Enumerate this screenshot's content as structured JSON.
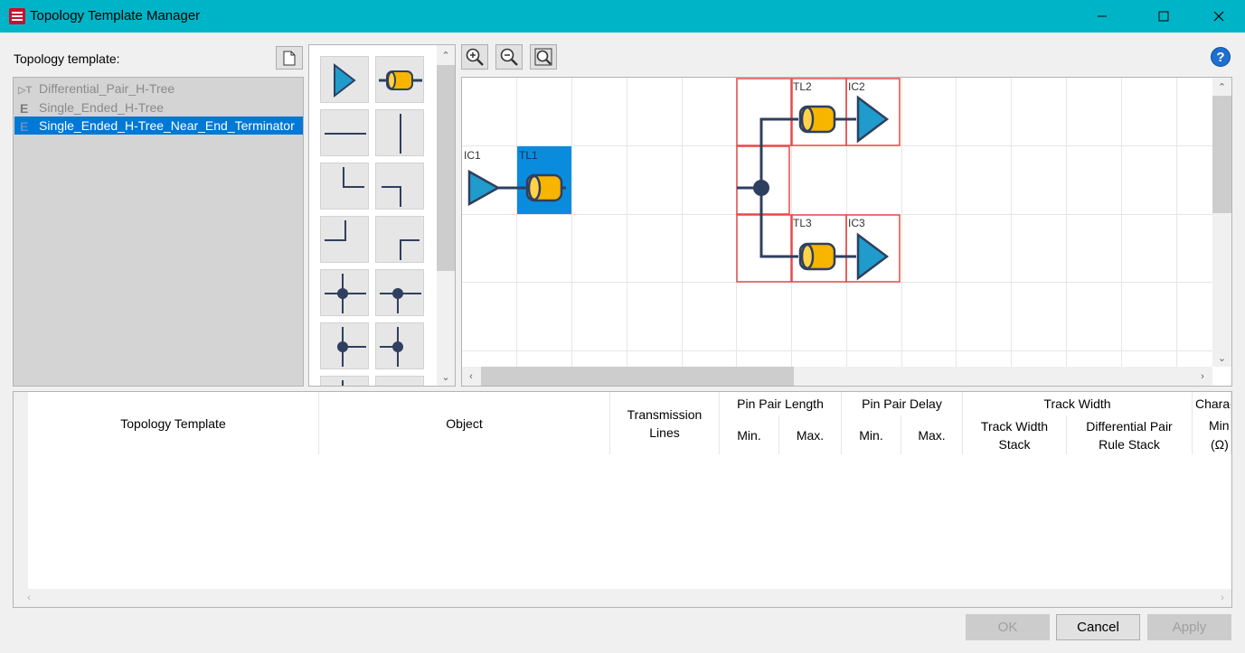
{
  "window": {
    "title": "Topology Template Manager",
    "minimize_glyph": "—",
    "maximize_glyph": "☐",
    "close_glyph": "✕"
  },
  "templates": {
    "label": "Topology template:",
    "items": [
      {
        "name": "Differential_Pair_H-Tree",
        "selected": false
      },
      {
        "name": "Single_Ended_H-Tree",
        "selected": false
      },
      {
        "name": "Single_Ended_H-Tree_Near_End_Terminator",
        "selected": true
      }
    ]
  },
  "palette": {
    "items": [
      "ic-driver",
      "transmission-line",
      "horizontal-wire",
      "vertical-wire",
      "corner-top-right",
      "corner-bottom-left",
      "corner-top-left",
      "corner-bottom-right",
      "tee-vertical",
      "tee-vertical-alt",
      "tee-left",
      "tee-right"
    ]
  },
  "canvas": {
    "components": [
      {
        "label": "IC1",
        "kind": "ic"
      },
      {
        "label": "TL1",
        "kind": "tline",
        "selected": true
      },
      {
        "label": "TL2",
        "kind": "tline"
      },
      {
        "label": "IC2",
        "kind": "ic"
      },
      {
        "label": "TL3",
        "kind": "tline"
      },
      {
        "label": "IC3",
        "kind": "ic"
      }
    ]
  },
  "table": {
    "columns": {
      "topology_template": "Topology Template",
      "object": "Object",
      "transmission_lines": "Transmission Lines",
      "pin_pair_length": "Pin Pair Length",
      "pin_pair_delay": "Pin Pair Delay",
      "min": "Min.",
      "max": "Max.",
      "track_width": "Track Width",
      "track_width_stack": "Track Width Stack",
      "differential_pair_rule_stack": "Differential Pair Rule Stack",
      "characteristic_cut": "Charac",
      "min_cut": "Min",
      "ohm": "(Ω)"
    }
  },
  "buttons": {
    "ok": "OK",
    "cancel": "Cancel",
    "apply": "Apply"
  },
  "colors": {
    "titlebar": "#00b4c8",
    "selection": "#0078d7",
    "wire": "#2f3f5f",
    "tline_fill": "#f7b500",
    "ic_fill": "#1f9ccc",
    "highlight_box": "#e84848"
  }
}
